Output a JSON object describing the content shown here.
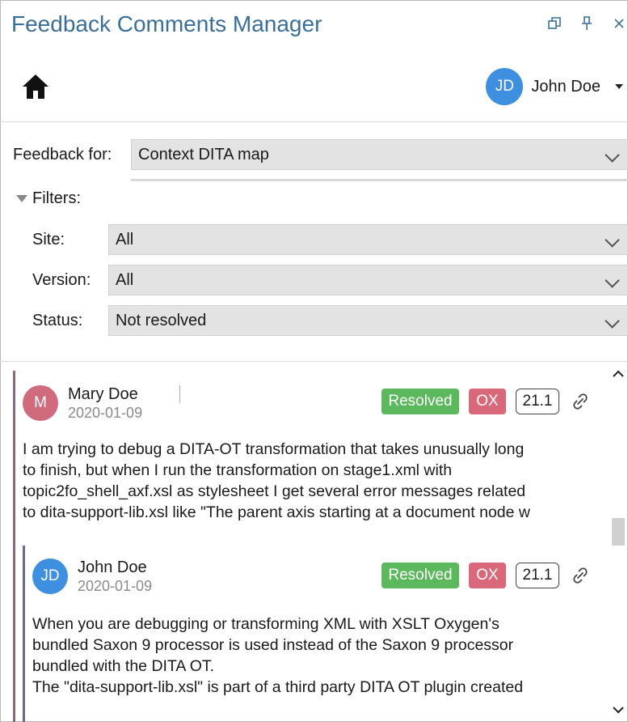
{
  "app": {
    "title": "Feedback Comments Manager"
  },
  "window_controls": [
    {
      "icon": "restore-icon"
    },
    {
      "icon": "pin-icon"
    },
    {
      "icon": "close-icon"
    }
  ],
  "user": {
    "initials": "JD",
    "name": "John Doe",
    "avatar_color": "#3f8fe0"
  },
  "feedback_for": {
    "label": "Feedback for:",
    "value": "Context DITA map"
  },
  "filters": {
    "toggle_label": "Filters:",
    "site": {
      "label": "Site:",
      "value": "All"
    },
    "version": {
      "label": "Version:",
      "value": "All"
    },
    "status": {
      "label": "Status:",
      "value": "Not resolved"
    }
  },
  "comments": [
    {
      "initials": "M",
      "avatar_color": "#cf6b7c",
      "author": "Mary Doe",
      "date": "2020-01-09",
      "status": "Resolved",
      "product": "OX",
      "version": "21.1",
      "lines": [
        "I am trying to debug a DITA-OT transformation that takes unusually  long",
        "to finish, but when I run the transformation on stage1.xml with",
        "topic2fo_shell_axf.xsl as stylesheet I get several error messages related",
        "to dita-support-lib.xsl like \"The parent axis starting at a document node w"
      ]
    },
    {
      "initials": "JD",
      "avatar_color": "#3f8fe0",
      "author": "John Doe",
      "date": "2020-01-09",
      "status": "Resolved",
      "product": "OX",
      "version": "21.1",
      "lines": [
        "When you are debugging or transforming XML with XSLT Oxygen's",
        "bundled Saxon 9 processor is used instead of the Saxon 9 processor",
        "bundled with the DITA OT.",
        "The \"dita-support-lib.xsl\" is part of a third party DITA OT plugin created"
      ]
    }
  ],
  "colors": {
    "title": "#3a6f9a",
    "resolved": "#5cb85c",
    "ox": "#d9687a",
    "thread_bar_outer": "#8a6a80",
    "thread_bar_inner": "#6a6a8a"
  }
}
